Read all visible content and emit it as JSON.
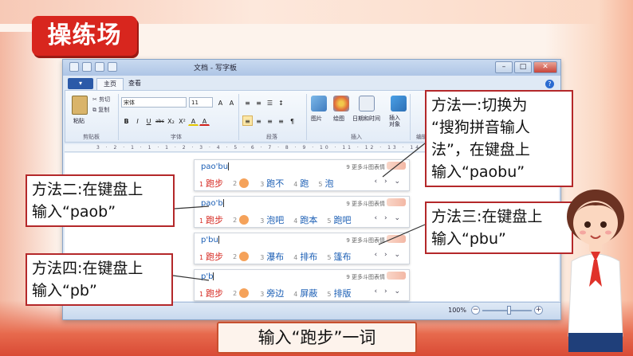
{
  "title": "操练场",
  "window": {
    "title": "文档 - 写字板",
    "controls": {
      "minimize": "–",
      "maximize": "□",
      "close": "✕"
    },
    "tabs": {
      "file": "▾",
      "home": "主页",
      "view": "查看"
    },
    "help": "?"
  },
  "ribbon": {
    "clipboard": {
      "paste": "粘贴",
      "cut": "剪切",
      "copy": "复制",
      "group": "剪贴板"
    },
    "font": {
      "name": "宋体",
      "size": "11",
      "group": "字体",
      "buttons": [
        "B",
        "I",
        "U",
        "abc",
        "X₂",
        "X²",
        "A",
        "A"
      ]
    },
    "paragraph": {
      "group": "段落"
    },
    "insert": {
      "picture": "图片",
      "paint": "绘图",
      "datetime": "日期和时间",
      "object": "插入\n对象",
      "group": "插入"
    },
    "editing": {
      "group": "编辑"
    }
  },
  "ruler": "3 · 2 · 1 · 1 · 1 · 2 · 3 · 4 · 5 · 6 · 7 · 8 · 9 · 10 · 11 · 12 · 13 · 14 · 15 · 16 · 17 ·",
  "ime": [
    {
      "input": "pao'bu",
      "more": "9 更多斗图表情",
      "candidates": [
        {
          "n": "1",
          "t": "跑步"
        },
        {
          "n": "3",
          "t": "跑不"
        },
        {
          "n": "4",
          "t": "跑"
        },
        {
          "n": "5",
          "t": "泡"
        }
      ],
      "emoji_n": "2"
    },
    {
      "input": "pao'b",
      "more": "9 更多斗图表情",
      "candidates": [
        {
          "n": "1",
          "t": "跑步"
        },
        {
          "n": "3",
          "t": "泡吧"
        },
        {
          "n": "4",
          "t": "跑本"
        },
        {
          "n": "5",
          "t": "跑吧"
        }
      ],
      "emoji_n": "2"
    },
    {
      "input": "p'bu",
      "more": "9 更多斗图表情",
      "candidates": [
        {
          "n": "1",
          "t": "跑步"
        },
        {
          "n": "3",
          "t": "瀑布"
        },
        {
          "n": "4",
          "t": "排布"
        },
        {
          "n": "5",
          "t": "篷布"
        }
      ],
      "emoji_n": "2"
    },
    {
      "input": "p'b",
      "more": "9 更多斗图表情",
      "candidates": [
        {
          "n": "1",
          "t": "跑步"
        },
        {
          "n": "3",
          "t": "旁边"
        },
        {
          "n": "4",
          "t": "屏蔽"
        },
        {
          "n": "5",
          "t": "排版"
        }
      ],
      "emoji_n": "2"
    }
  ],
  "ime_nav": "‹ › ⌄",
  "callouts": {
    "m1": [
      "方法一:切换为",
      "“搜狗拼音输人",
      "法”，在键盘上",
      "输入“paobu”"
    ],
    "m2": [
      "方法二:在键盘上",
      "输入“paob”"
    ],
    "m3": [
      "方法三:在键盘上",
      "输入“pbu”"
    ],
    "m4": [
      "方法四:在键盘上",
      "输入“pb”"
    ]
  },
  "status": {
    "zoom": "100%",
    "minus": "−",
    "plus": "+",
    "zoom_level_percent": 100
  },
  "caption": "输入“跑步”一词",
  "colors": {
    "accent_red": "#d8261e",
    "callout_border": "#b4282a",
    "candidate_blue": "#1c5fb5",
    "candidate_first": "#d62a22"
  }
}
